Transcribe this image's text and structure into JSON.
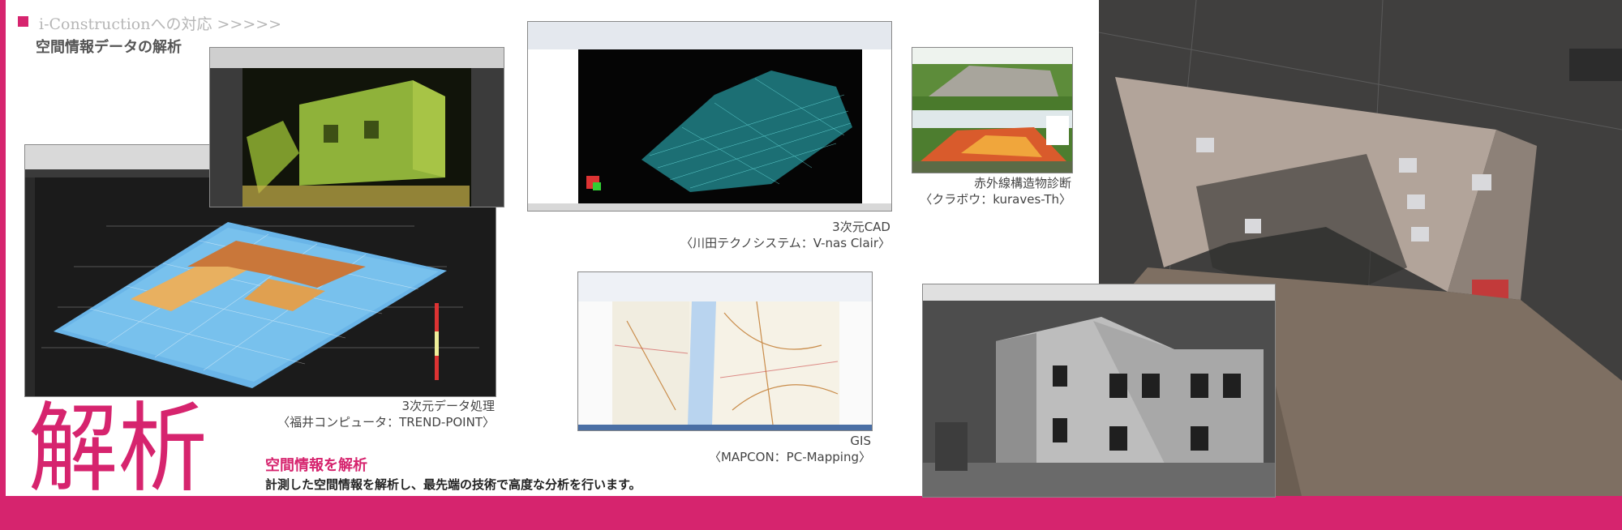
{
  "header": {
    "title": "i-Constructionへの対応 >>>>>",
    "subtitle": "空間情報データの解析"
  },
  "captions": {
    "trend_point": {
      "line1": "3次元データ処理",
      "line2": "〈福井コンピュータ：TREND-POINT〉"
    },
    "vnas": {
      "line1": "3次元CAD",
      "line2": "〈川田テクノシステム：V-nas Clair〉"
    },
    "infrared": {
      "line1": "赤外線構造物診断",
      "line2": "〈クラボウ：kuraves-Th〉"
    },
    "gis": {
      "line1": "GIS",
      "line2": "〈MAPCON：PC-Mapping〉"
    }
  },
  "section": {
    "big_text": "解析",
    "title": "空間情報を解析",
    "body": "計測した空間情報を解析し、最先端の技術で高度な分析を行います。"
  },
  "colors": {
    "accent": "#d6246e",
    "caption": "#444444"
  }
}
